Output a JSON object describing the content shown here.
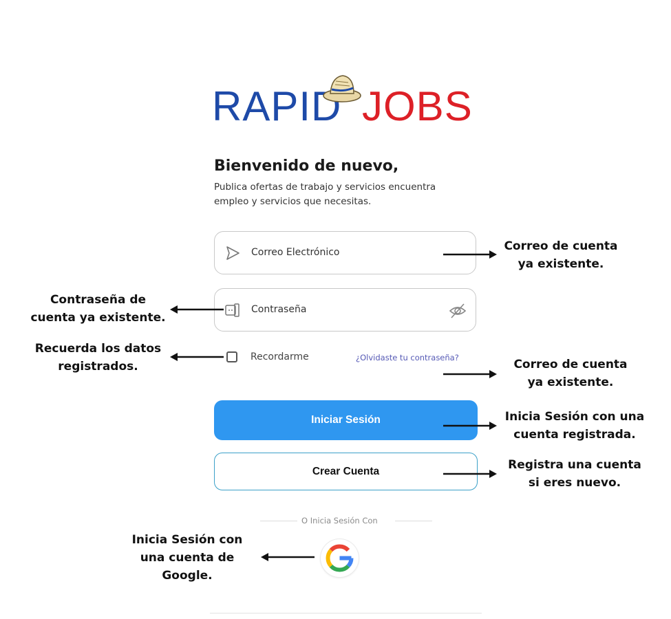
{
  "logo": {
    "part1": "RAPID",
    "part2": "JOBS",
    "icon": "hat-icon"
  },
  "welcome": {
    "title": "Bienvenido de nuevo,",
    "subtitle_line1": "Publica ofertas de trabajo y servicios encuentra",
    "subtitle_line2": "empleo y servicios que necesitas."
  },
  "form": {
    "email_placeholder": "Correo Electrónico",
    "password_placeholder": "Contraseña",
    "remember_label": "Recordarme",
    "forgot_link": "¿Olvidaste tu contraseña?",
    "login_button": "Iniciar Sesión",
    "create_button": "Crear Cuenta",
    "divider_text": "O Inicia Sesión Con"
  },
  "annotations": {
    "email_line1": "Correo de cuenta",
    "email_line2": "ya existente.",
    "password_line1": "Contraseña de",
    "password_line2": "cuenta ya existente.",
    "remember_line1": "Recuerda los datos",
    "remember_line2": "registrados.",
    "forgot_line1": "Correo de cuenta",
    "forgot_line2": "ya existente.",
    "login_line1": "Inicia Sesión con una",
    "login_line2": "cuenta registrada.",
    "create_line1": "Registra una cuenta",
    "create_line2": "si eres nuevo.",
    "google_line1": "Inicia Sesión con",
    "google_line2": "una cuenta de",
    "google_line3": "Google."
  },
  "colors": {
    "brand_blue": "#1e4aa8",
    "brand_red": "#dd2027",
    "primary_button": "#2f97f0",
    "outline_border": "#3aa0c8",
    "link": "#5559b5"
  }
}
